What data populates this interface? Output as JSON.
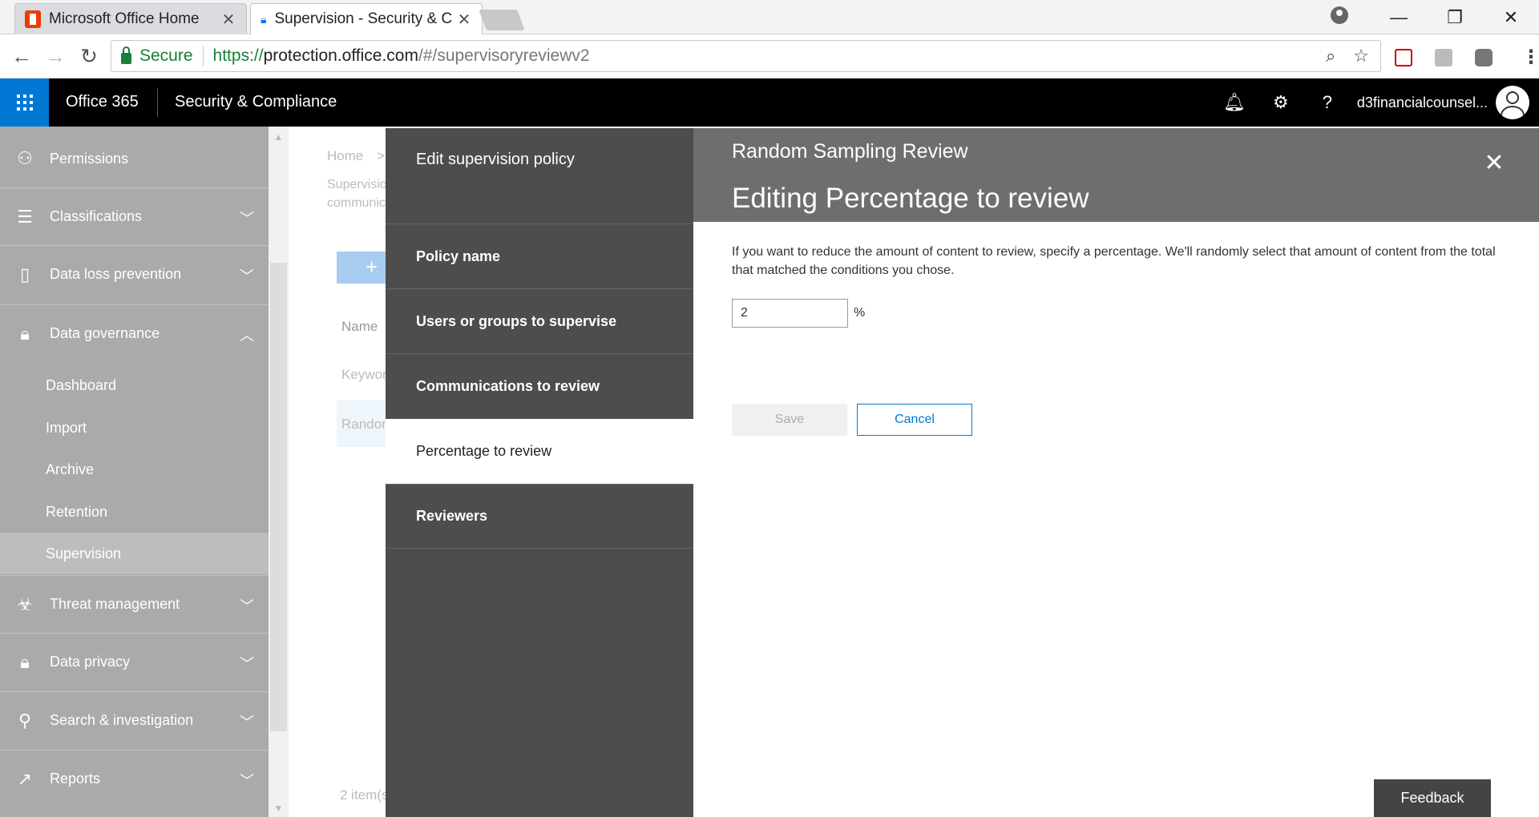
{
  "browser": {
    "tabs": [
      {
        "title": "Microsoft Office Home",
        "close": "✕"
      },
      {
        "title": "Supervision - Security & C",
        "close": "✕"
      }
    ],
    "window_controls": {
      "minimize": "—",
      "restore": "❐",
      "close": "✕"
    },
    "secure_label": "Secure",
    "url_scheme": "https://",
    "url_host": "protection.office.com",
    "url_path": "/#/supervisoryreviewv2"
  },
  "o365": {
    "brand": "Office 365",
    "app_name": "Security & Compliance",
    "account_name": "d3financialcounsel...",
    "help": "?"
  },
  "leftnav": {
    "items": [
      {
        "label": "Permissions",
        "icon": "people-icon"
      },
      {
        "label": "Classifications",
        "icon": "list-icon"
      },
      {
        "label": "Data loss prevention",
        "icon": "document-lock-icon"
      },
      {
        "label": "Data governance",
        "icon": "lock-icon"
      },
      {
        "label": "Threat management",
        "icon": "biohazard-icon"
      },
      {
        "label": "Data privacy",
        "icon": "lock-icon"
      },
      {
        "label": "Search & investigation",
        "icon": "search-icon"
      },
      {
        "label": "Reports",
        "icon": "chart-icon"
      }
    ],
    "sub_items": [
      "Dashboard",
      "Import",
      "Archive",
      "Retention",
      "Supervision"
    ]
  },
  "background_page": {
    "breadcrumb_home": "Home",
    "breadcrumb_sep": ">",
    "desc_line1": "Supervisio",
    "desc_line2": "communic",
    "add_button": "+",
    "col_name": "Name",
    "row1": "Keywor",
    "row2": "Random",
    "item_count": "2 item(s"
  },
  "flyout": {
    "nav_title": "Edit supervision policy",
    "steps": [
      {
        "label": "Policy name"
      },
      {
        "label": "Users or groups to supervise"
      },
      {
        "label": "Communications to review"
      },
      {
        "label": "Percentage to review"
      },
      {
        "label": "Reviewers"
      }
    ],
    "policy_name": "Random Sampling Review",
    "title": "Editing Percentage to review",
    "description": "If you want to reduce the amount of content to review, specify a percentage. We'll randomly select that amount of content from the total that matched the conditions you chose.",
    "percentage_value": "2",
    "percentage_unit": "%",
    "save_label": "Save",
    "cancel_label": "Cancel",
    "close": "✕"
  },
  "feedback_label": "Feedback"
}
